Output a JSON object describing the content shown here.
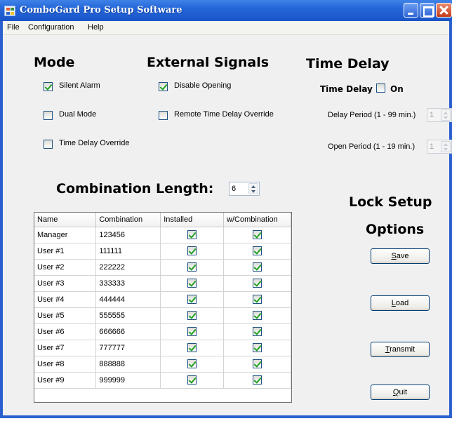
{
  "window": {
    "title": "ComboGard Pro Setup Software"
  },
  "menu": {
    "items": [
      "File",
      "Configuration",
      "Help"
    ]
  },
  "mode": {
    "title": "Mode",
    "options": [
      {
        "label": "Silent Alarm",
        "checked": true
      },
      {
        "label": "Dual Mode",
        "checked": false
      },
      {
        "label": "Time Delay Override",
        "checked": false
      }
    ]
  },
  "external_signals": {
    "title": "External Signals",
    "options": [
      {
        "label": "Disable Opening",
        "checked": true
      },
      {
        "label": "Remote Time Delay Override",
        "checked": false
      }
    ]
  },
  "time_delay": {
    "title": "Time Delay",
    "toggle_label": "Time Delay",
    "on_label": "On",
    "on_checked": false,
    "delay_period_label": "Delay Period (1 - 99 min.)",
    "delay_period_value": "1",
    "open_period_label": "Open Period (1 - 19 min.)",
    "open_period_value": "1"
  },
  "combination": {
    "label": "Combination Length:",
    "value": "6"
  },
  "table": {
    "columns": [
      "Name",
      "Combination",
      "Installed",
      "w/Combination"
    ],
    "rows": [
      {
        "name": "Manager",
        "combination": "123456",
        "installed": true,
        "with_combination": true
      },
      {
        "name": "User #1",
        "combination": "111111",
        "installed": true,
        "with_combination": true
      },
      {
        "name": "User #2",
        "combination": "222222",
        "installed": true,
        "with_combination": true
      },
      {
        "name": "User #3",
        "combination": "333333",
        "installed": true,
        "with_combination": true
      },
      {
        "name": "User #4",
        "combination": "444444",
        "installed": true,
        "with_combination": true
      },
      {
        "name": "User #5",
        "combination": "555555",
        "installed": true,
        "with_combination": true
      },
      {
        "name": "User #6",
        "combination": "666666",
        "installed": true,
        "with_combination": true
      },
      {
        "name": "User #7",
        "combination": "777777",
        "installed": true,
        "with_combination": true
      },
      {
        "name": "User #8",
        "combination": "888888",
        "installed": true,
        "with_combination": true
      },
      {
        "name": "User #9",
        "combination": "999999",
        "installed": true,
        "with_combination": true
      }
    ]
  },
  "lock_setup": {
    "title_line1": "Lock Setup",
    "title_line2": "Options",
    "buttons": [
      {
        "key": "S",
        "rest": "ave"
      },
      {
        "key": "L",
        "rest": "oad"
      },
      {
        "key": "T",
        "rest": "ransmit"
      },
      {
        "key": "Q",
        "rest": "uit"
      }
    ]
  },
  "colors": {
    "title_bar": "#2466d9",
    "check_mark": "#21a121",
    "window_bg": "#f0f0f0"
  }
}
